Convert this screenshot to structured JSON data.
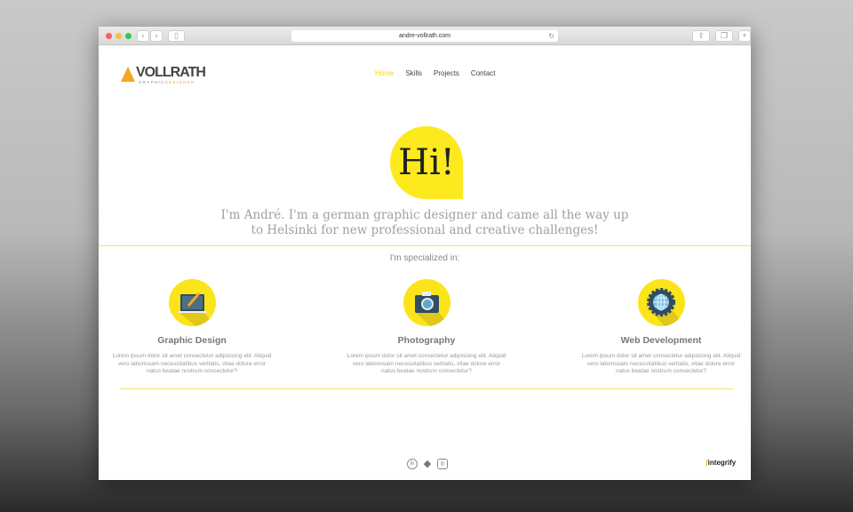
{
  "browser": {
    "url": "andre-vollrath.com"
  },
  "logo": {
    "name": "VOLLRATH",
    "sub_a": "GRAPHIC",
    "sub_b": "DESIGNER"
  },
  "nav": [
    {
      "label": "Home",
      "active": true
    },
    {
      "label": "Skills"
    },
    {
      "label": "Projects"
    },
    {
      "label": "Contact"
    }
  ],
  "hero": {
    "greeting": "Hi!",
    "intro_line1": "I'm André. I'm a german graphic designer and came all the way up",
    "intro_line2": "to Helsinki for new professional and creative challenges!"
  },
  "specialized": {
    "heading": "I'm specialized in:",
    "items": [
      {
        "title": "Graphic Design",
        "icon": "laptop-brush-icon",
        "text": "Lorem ipsum dolor sit amet consectetur adipisicing elit. Aliquid vero laboriosam necessitatibus veritatis, vitae dolore error natus beatae nostrum consectetur?"
      },
      {
        "title": "Photography",
        "icon": "camera-icon",
        "text": "Lorem ipsum dolor sit amet consectetur adipisicing elit. Aliquid vero laboriosam necessitatibus veritatis, vitae dolore error natus beatae nostrum consectetur?"
      },
      {
        "title": "Web Development",
        "icon": "globe-gear-icon",
        "text": "Lorem ipsum dolor sit amet consectetur adipisicing elit. Aliquid vero laboriosam necessitatibus veritatis, vitae dolore error natus beatae nostrum consectetur?"
      }
    ]
  },
  "footer": {
    "social": [
      "in",
      "◆",
      "◎"
    ],
    "brand": "integrify",
    "brand_mark": "ʃ"
  },
  "colors": {
    "accent": "#fcea1e",
    "text": "#777777"
  }
}
